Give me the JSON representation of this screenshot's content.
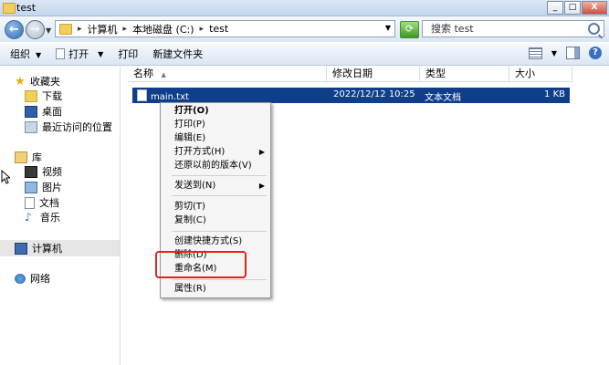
{
  "window": {
    "title": "test"
  },
  "nav": {
    "back_glyph": "←",
    "forward_glyph": "→",
    "breadcrumbs": [
      "计算机",
      "本地磁盘 (C:)",
      "test"
    ],
    "breadcrumb_sep": "▸",
    "refresh_glyph": "⟳",
    "search_placeholder": "搜索 test"
  },
  "window_buttons": {
    "minimize": "_",
    "maximize": "□",
    "close": "X"
  },
  "toolbar": {
    "organize": "组织",
    "open": "打开",
    "print": "打印",
    "new_folder": "新建文件夹",
    "help": "?"
  },
  "sidebar": {
    "favorites": {
      "label": "收藏夹",
      "items": [
        "下载",
        "桌面",
        "最近访问的位置"
      ]
    },
    "libraries": {
      "label": "库",
      "items": [
        "视频",
        "图片",
        "文档",
        "音乐"
      ]
    },
    "computer": "计算机",
    "network": "网络"
  },
  "columns": [
    "名称",
    "修改日期",
    "类型",
    "大小"
  ],
  "files": [
    {
      "name": "main.txt",
      "modified": "2022/12/12 10:25",
      "type": "文本文档",
      "size": "1 KB"
    }
  ],
  "context_menu": {
    "open": "打开(O)",
    "print": "打印(P)",
    "edit": "编辑(E)",
    "open_with": "打开方式(H)",
    "restore": "还原以前的版本(V)",
    "send_to": "发送到(N)",
    "cut": "剪切(T)",
    "copy": "复制(C)",
    "create_shortcut": "创建快捷方式(S)",
    "delete": "删除(D)",
    "rename": "重命名(M)",
    "properties": "属性(R)"
  },
  "colors": {
    "selection": "#0f3f8a",
    "highlight_box": "#e0241f",
    "accent": "#3a6fc1"
  }
}
